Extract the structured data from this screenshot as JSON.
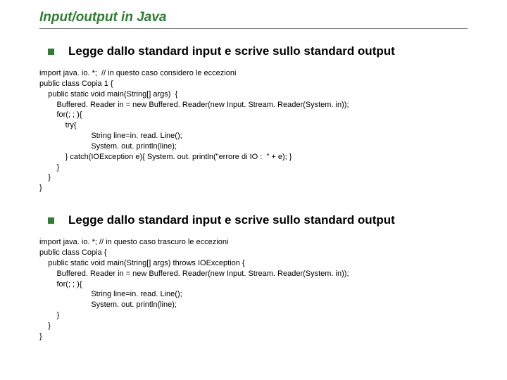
{
  "title": "Input/output in Java",
  "section1": {
    "heading": "Legge dallo standard input e scrive sullo standard output",
    "code": "import java. io. *;  // in questo caso considero le eccezioni\npublic class Copia 1 {\n    public static void main(String[] args)  {\n        Buffered. Reader in = new Buffered. Reader(new Input. Stream. Reader(System. in));\n        for(; ; ){\n            try{\n                        String line=in. read. Line();\n                        System. out. println(line);\n            } catch(IOException e){ System. out. println(\"errore di IO :  \" + e); }\n        }\n    }\n}"
  },
  "section2": {
    "heading": "Legge dallo standard input e scrive sullo standard output",
    "code": "import java. io. *; // in questo caso trascuro le eccezioni\npublic class Copia {\n    public static void main(String[] args) throws IOException {\n        Buffered. Reader in = new Buffered. Reader(new Input. Stream. Reader(System. in));\n        for(; ; ){\n                        String line=in. read. Line();\n                        System. out. println(line);\n        }\n    }\n}"
  }
}
